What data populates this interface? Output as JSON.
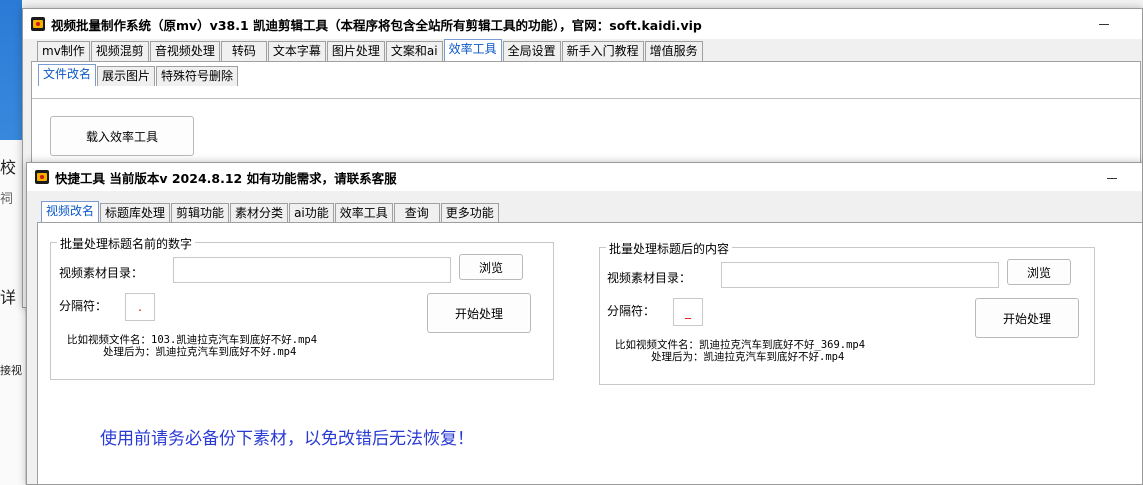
{
  "background_fragments": [
    "校",
    "祠",
    "详 (",
    "接视"
  ],
  "main_window": {
    "title": "视频批量制作系统（原mv）v38.1     凯迪剪辑工具（本程序将包含全站所有剪辑工具的功能），官网：soft.kaidi.vip",
    "tabs": [
      "mv制作",
      "视频混剪",
      "音视频处理",
      "转码",
      "文本字幕",
      "图片处理",
      "文案和ai",
      "效率工具",
      "全局设置",
      "新手入门教程",
      "增值服务"
    ],
    "active_tab": "效率工具",
    "subtabs": [
      "文件改名",
      "展示图片",
      "特殊符号删除"
    ],
    "active_subtab": "文件改名",
    "load_button": "载入效率工具"
  },
  "quick_window": {
    "title": "快捷工具 当前版本v 2024.8.12     如有功能需求，请联系客服",
    "tabs": [
      "视频改名",
      "标题库处理",
      "剪辑功能",
      "素材分类",
      "ai功能",
      "效率工具",
      "查询",
      "更多功能"
    ],
    "active_tab": "视频改名",
    "left_group": {
      "legend": "批量处理标题名前的数字",
      "dir_label": "视频素材目录：",
      "dir_value": "",
      "browse_button": "浏览",
      "sep_label": "分隔符：",
      "sep_value": ".",
      "start_button": "开始处理",
      "example_line1": "比如视频文件名：103.凯迪拉克汽车到底好不好.mp4",
      "example_line2": "处理后为：凯迪拉克汽车到底好不好.mp4"
    },
    "right_group": {
      "legend": "批量处理标题后的内容",
      "dir_label": "视频素材目录：",
      "dir_value": "",
      "browse_button": "浏览",
      "sep_label": "分隔符：",
      "sep_value": "_",
      "start_button": "开始处理",
      "example_line1": "比如视频文件名：凯迪拉克汽车到底好不好_369.mp4",
      "example_line2": "处理后为：凯迪拉克汽车到底好不好.mp4"
    },
    "warning": "使用前请务必备份下素材，以免改错后无法恢复！"
  },
  "colors": {
    "active_tab": "#0a58c8",
    "warning": "#2a3bd4",
    "separator": "#dd0000"
  }
}
